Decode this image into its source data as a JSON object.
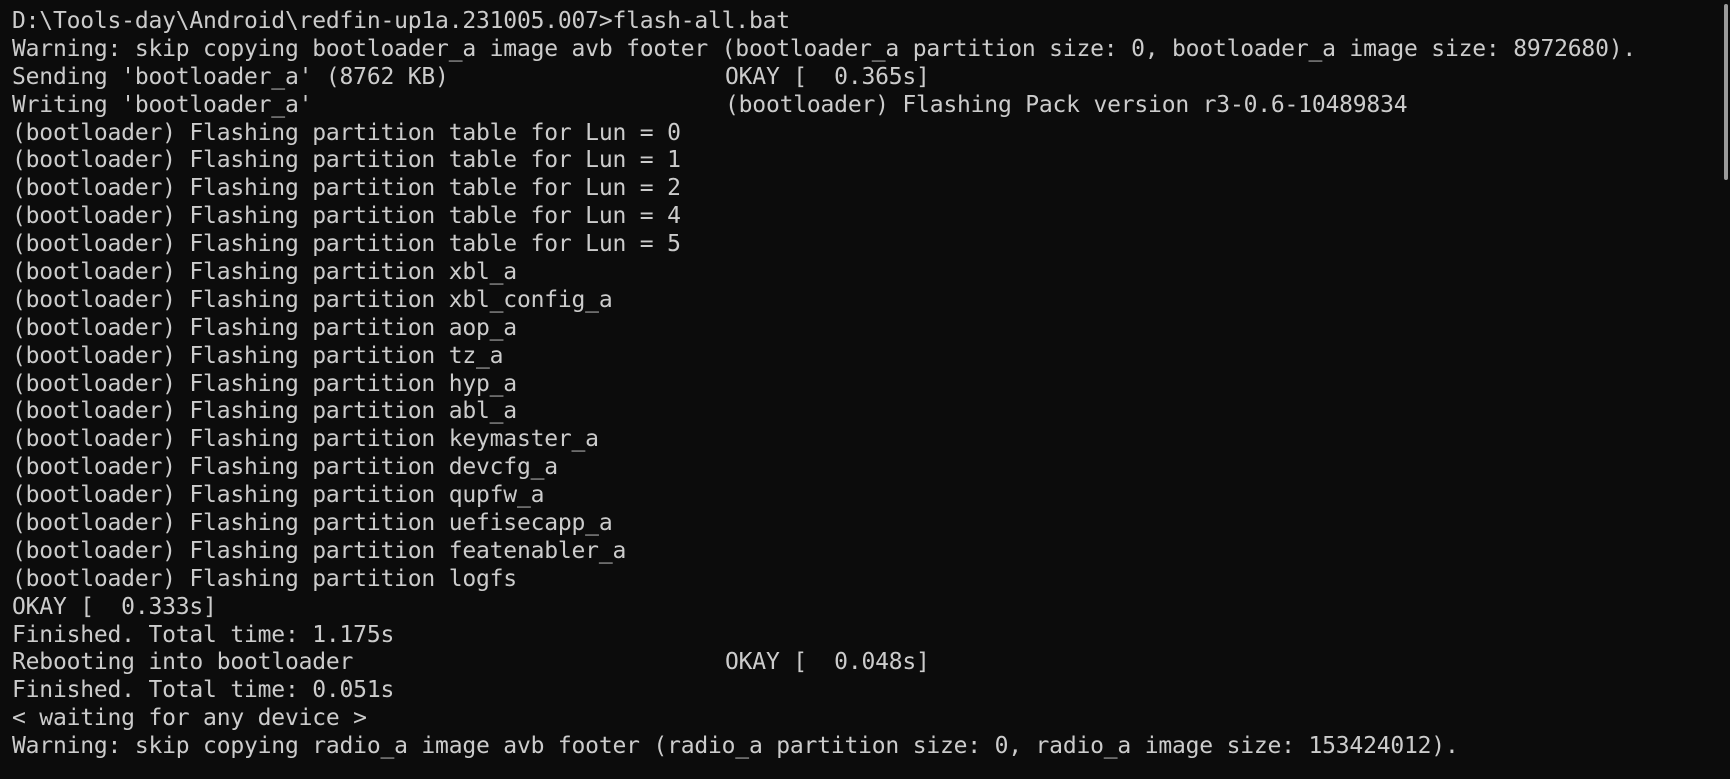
{
  "terminal": {
    "lines": [
      {
        "left": "D:\\Tools-day\\Android\\redfin-up1a.231005.007>flash-all.bat",
        "right": ""
      },
      {
        "left": "Warning: skip copying bootloader_a image avb footer (bootloader_a partition size: 0, bootloader_a image size: 8972680).",
        "right": ""
      },
      {
        "left": "Sending 'bootloader_a' (8762 KB)",
        "right": "OKAY [  0.365s]"
      },
      {
        "left": "Writing 'bootloader_a'",
        "right": "(bootloader) Flashing Pack version r3-0.6-10489834"
      },
      {
        "left": "(bootloader) Flashing partition table for Lun = 0",
        "right": ""
      },
      {
        "left": "(bootloader) Flashing partition table for Lun = 1",
        "right": ""
      },
      {
        "left": "(bootloader) Flashing partition table for Lun = 2",
        "right": ""
      },
      {
        "left": "(bootloader) Flashing partition table for Lun = 4",
        "right": ""
      },
      {
        "left": "(bootloader) Flashing partition table for Lun = 5",
        "right": ""
      },
      {
        "left": "(bootloader) Flashing partition xbl_a",
        "right": ""
      },
      {
        "left": "(bootloader) Flashing partition xbl_config_a",
        "right": ""
      },
      {
        "left": "(bootloader) Flashing partition aop_a",
        "right": ""
      },
      {
        "left": "(bootloader) Flashing partition tz_a",
        "right": ""
      },
      {
        "left": "(bootloader) Flashing partition hyp_a",
        "right": ""
      },
      {
        "left": "(bootloader) Flashing partition abl_a",
        "right": ""
      },
      {
        "left": "(bootloader) Flashing partition keymaster_a",
        "right": ""
      },
      {
        "left": "(bootloader) Flashing partition devcfg_a",
        "right": ""
      },
      {
        "left": "(bootloader) Flashing partition qupfw_a",
        "right": ""
      },
      {
        "left": "(bootloader) Flashing partition uefisecapp_a",
        "right": ""
      },
      {
        "left": "(bootloader) Flashing partition featenabler_a",
        "right": ""
      },
      {
        "left": "(bootloader) Flashing partition logfs",
        "right": ""
      },
      {
        "left": "OKAY [  0.333s]",
        "right": ""
      },
      {
        "left": "Finished. Total time: 1.175s",
        "right": ""
      },
      {
        "left": "Rebooting into bootloader",
        "right": "OKAY [  0.048s]"
      },
      {
        "left": "Finished. Total time: 0.051s",
        "right": ""
      },
      {
        "left": "< waiting for any device >",
        "right": ""
      },
      {
        "left": "Warning: skip copying radio_a image avb footer (radio_a partition size: 0, radio_a image size: 153424012).",
        "right": ""
      }
    ]
  },
  "colors": {
    "background": "#0c0c0c",
    "text": "#cccccc",
    "scrollbar_thumb": "#9a9a9a"
  }
}
